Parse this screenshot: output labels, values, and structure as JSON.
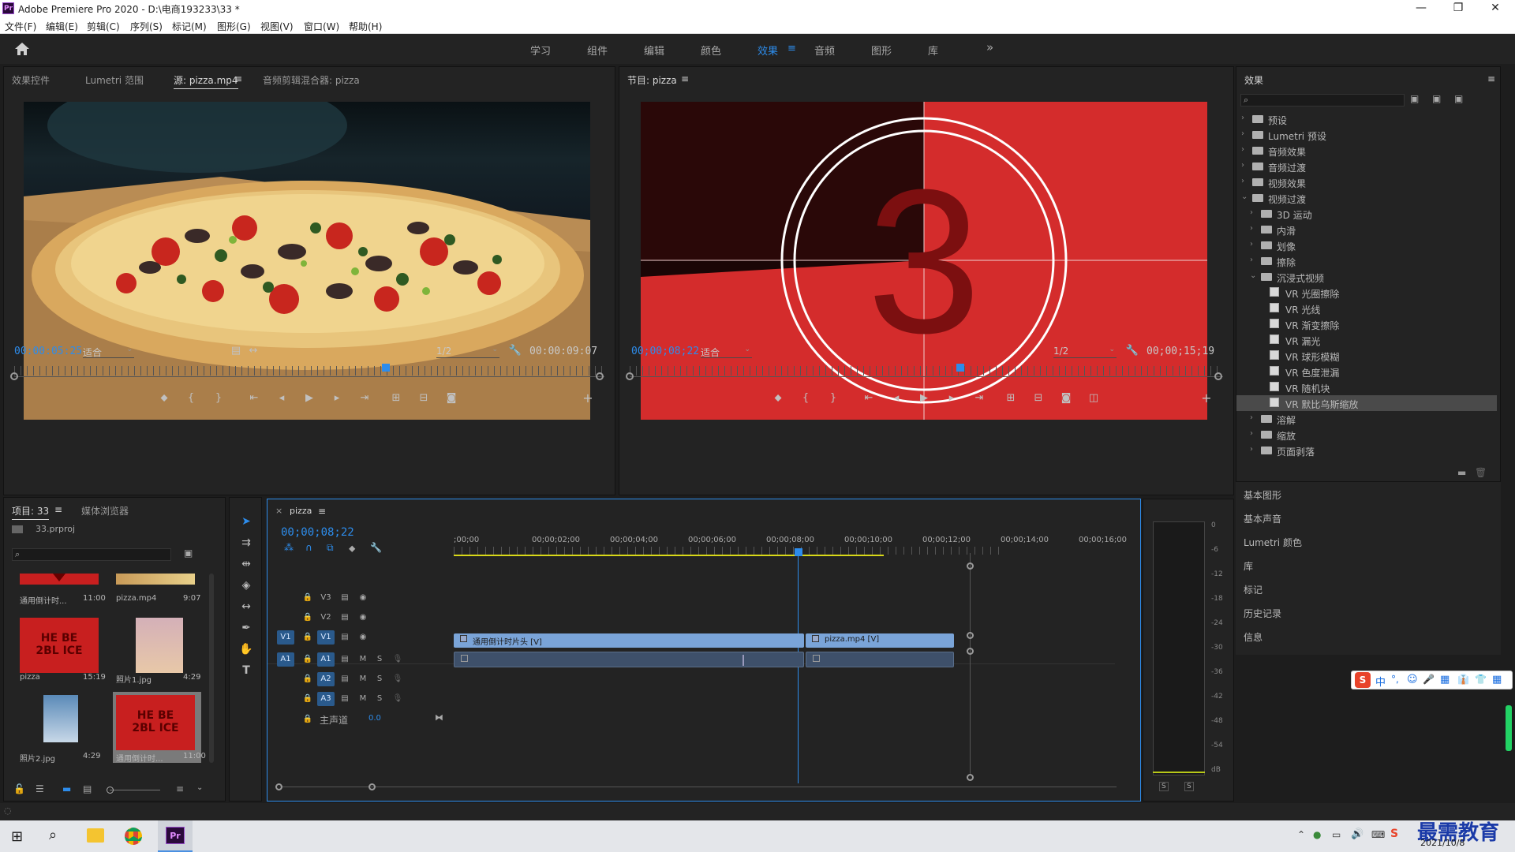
{
  "window": {
    "app_logo": "Pr",
    "title": "Adobe Premiere Pro 2020 - D:\\电商193233\\33 *",
    "minimize": "—",
    "restore": "❐",
    "close": "✕"
  },
  "menu": [
    "文件(F)",
    "编辑(E)",
    "剪辑(C)",
    "序列(S)",
    "标记(M)",
    "图形(G)",
    "视图(V)",
    "窗口(W)",
    "帮助(H)"
  ],
  "workspaces": {
    "items": [
      "学习",
      "组件",
      "编辑",
      "颜色",
      "效果",
      "音频",
      "图形",
      "库"
    ],
    "active": "效果",
    "more": "»",
    "menu_icon": "≡"
  },
  "source_panel": {
    "tabs": [
      "效果控件",
      "Lumetri 范围",
      "源: pizza.mp4",
      "音频剪辑混合器: pizza"
    ],
    "active_tab": "源: pizza.mp4",
    "timecode": "00:00:05:25",
    "fit": "适合",
    "resolution": "1/2",
    "duration": "00:00:09:07",
    "playhead_fraction": 0.63
  },
  "program_panel": {
    "tab": "节目: pizza",
    "timecode": "00;00;08;22",
    "fit": "适合",
    "resolution": "1/2",
    "duration": "00;00;15;19",
    "countdown_number": "3",
    "playhead_fraction": 0.557
  },
  "effects_panel": {
    "title": "效果",
    "search_placeholder": "",
    "tree": [
      {
        "label": "预设",
        "level": 0,
        "type": "folder",
        "open": false
      },
      {
        "label": "Lumetri 预设",
        "level": 0,
        "type": "folder",
        "open": false
      },
      {
        "label": "音频效果",
        "level": 0,
        "type": "folder",
        "open": false
      },
      {
        "label": "音频过渡",
        "level": 0,
        "type": "folder",
        "open": false
      },
      {
        "label": "视频效果",
        "level": 0,
        "type": "folder",
        "open": false
      },
      {
        "label": "视频过渡",
        "level": 0,
        "type": "folder",
        "open": true
      },
      {
        "label": "3D 运动",
        "level": 1,
        "type": "folder",
        "open": false
      },
      {
        "label": "内滑",
        "level": 1,
        "type": "folder",
        "open": false
      },
      {
        "label": "划像",
        "level": 1,
        "type": "folder",
        "open": false
      },
      {
        "label": "擦除",
        "level": 1,
        "type": "folder",
        "open": false
      },
      {
        "label": "沉浸式视频",
        "level": 1,
        "type": "folder",
        "open": true
      },
      {
        "label": "VR 光圈擦除",
        "level": 2,
        "type": "fx"
      },
      {
        "label": "VR 光线",
        "level": 2,
        "type": "fx"
      },
      {
        "label": "VR 渐变擦除",
        "level": 2,
        "type": "fx"
      },
      {
        "label": "VR 漏光",
        "level": 2,
        "type": "fx"
      },
      {
        "label": "VR 球形模糊",
        "level": 2,
        "type": "fx"
      },
      {
        "label": "VR 色度泄漏",
        "level": 2,
        "type": "fx"
      },
      {
        "label": "VR 随机块",
        "level": 2,
        "type": "fx"
      },
      {
        "label": "VR 默比乌斯缩放",
        "level": 2,
        "type": "fx",
        "selected": true
      },
      {
        "label": "溶解",
        "level": 1,
        "type": "folder",
        "open": false
      },
      {
        "label": "缩放",
        "level": 1,
        "type": "folder",
        "open": false
      },
      {
        "label": "页面剥落",
        "level": 1,
        "type": "folder",
        "open": false
      }
    ],
    "side_panels": [
      "基本图形",
      "基本声音",
      "Lumetri 颜色",
      "库",
      "标记",
      "历史记录",
      "信息"
    ]
  },
  "project_panel": {
    "tabs": [
      "项目: 33",
      "媒体浏览器"
    ],
    "active_tab": "项目: 33",
    "file": "33.prproj",
    "items": [
      {
        "name": "通用倒计时...",
        "duration": "11:00"
      },
      {
        "name": "pizza.mp4",
        "duration": "9:07"
      },
      {
        "name": "pizza",
        "duration": "15:19"
      },
      {
        "name": "照片1.jpg",
        "duration": "4:29"
      },
      {
        "name": "照片2.jpg",
        "duration": "4:29"
      },
      {
        "name": "通用倒计时...",
        "duration": "11:00"
      }
    ],
    "thumb_text": "HE BE\n2BL ICE"
  },
  "timeline": {
    "tab": "pizza",
    "close": "×",
    "timecode": "00;00;08;22",
    "ruler_labels": [
      ";00;00",
      "00;00;02;00",
      "00;00;04;00",
      "00;00;06;00",
      "00;00;08;00",
      "00;00;10;00",
      "00;00;12;00",
      "00;00;14;00",
      "00;00;16;00"
    ],
    "video_tracks": [
      "V3",
      "V2",
      "V1"
    ],
    "audio_tracks": [
      "A1",
      "A2",
      "A3"
    ],
    "source_patch_v": "V1",
    "source_patch_a": "A1",
    "master": "主声道",
    "master_value": "0.0",
    "clips_video": [
      {
        "name": "通用倒计时片头 [V]"
      },
      {
        "name": "pizza.mp4 [V]"
      }
    ],
    "mute": "M",
    "solo": "S"
  },
  "audio_meter": {
    "labels": [
      "0",
      "-6",
      "-12",
      "-18",
      "-24",
      "-30",
      "-36",
      "-42",
      "-48",
      "-54",
      "dB"
    ],
    "solo_left": "S",
    "solo_right": "S"
  },
  "ime_toolbar": [
    "S",
    "中",
    "°,",
    "☺",
    "🎤",
    "▦",
    "👔",
    "👕",
    "▦"
  ],
  "taskbar": {
    "date": "2021/10/8",
    "watermark": "最需教育"
  }
}
